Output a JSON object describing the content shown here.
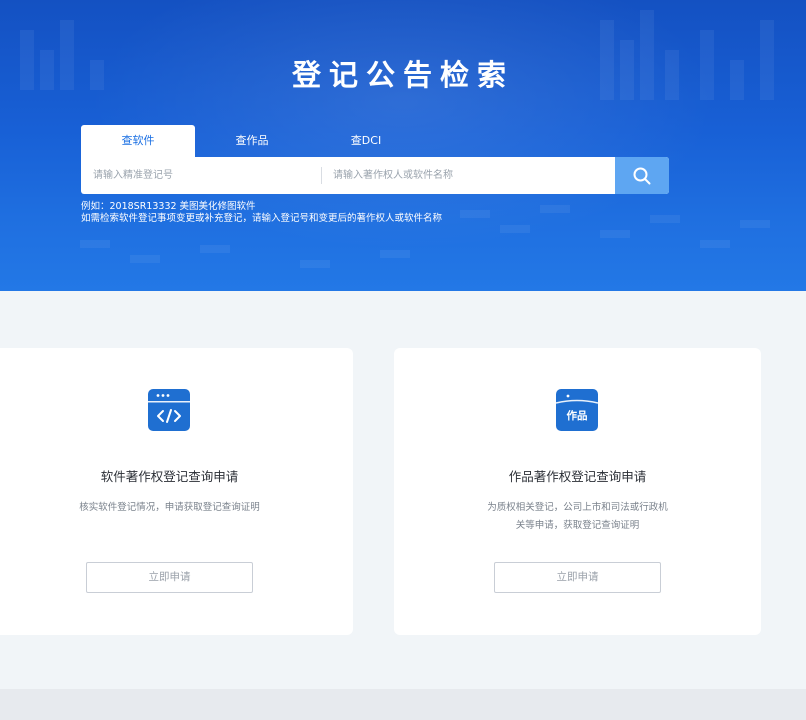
{
  "hero": {
    "title": "登记公告检索",
    "tabs": [
      {
        "label": "查软件",
        "active": true
      },
      {
        "label": "查作品",
        "active": false
      },
      {
        "label": "查DCI",
        "active": false
      }
    ],
    "search": {
      "reg_placeholder": "请输入精准登记号",
      "name_placeholder": "请输入著作权人或软件名称",
      "button_icon": "search-icon"
    },
    "hints": [
      "例如：2018SR13332 美图美化修图软件",
      "如需检索软件登记事项变更或补充登记，请输入登记号和变更后的著作权人或软件名称"
    ]
  },
  "cards": [
    {
      "icon": "code-window-icon",
      "title": "软件著作权登记查询申请",
      "desc_lines": [
        "核实软件登记情况，申请获取登记查询证明"
      ],
      "button": "立即申请"
    },
    {
      "icon": "works-window-icon",
      "icon_text": "作品",
      "title": "作品著作权登记查询申请",
      "desc_lines": [
        "为质权相关登记，公司上市和司法或行政机",
        "关等申请，获取登记查询证明"
      ],
      "button": "立即申请"
    }
  ],
  "colors": {
    "hero_blue": "#1860d6",
    "active_tab_text": "#1a6fe3",
    "search_button": "#5ea6f2",
    "icon_blue": "#1f6fd1",
    "page_bg": "#f1f5f8"
  }
}
